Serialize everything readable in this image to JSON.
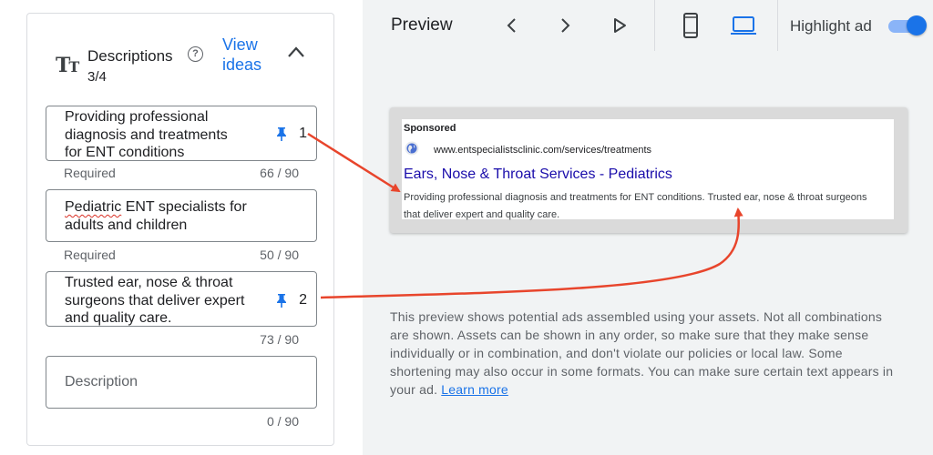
{
  "descriptions": {
    "title": "Descriptions",
    "count": "3/4",
    "view_ideas": "View ideas",
    "fields": [
      {
        "text": "Providing professional diagnosis and treatments for ENT conditions",
        "pin": "1",
        "required": "Required",
        "char_count": "66 / 90"
      },
      {
        "text_part1": "Pediatric",
        "text_part2": " ENT specialists for adults and children",
        "required": "Required",
        "char_count": "50 / 90"
      },
      {
        "text": "Trusted ear, nose & throat surgeons that deliver expert and quality care.",
        "pin": "2",
        "char_count": "73 / 90"
      },
      {
        "placeholder": "Description",
        "char_count": "0 / 90"
      }
    ]
  },
  "preview": {
    "title": "Preview",
    "highlight_label": "Highlight ad",
    "highlight_on": true,
    "selected_device": "desktop",
    "ad": {
      "sponsored": "Sponsored",
      "url": "www.entspecialistsclinic.com/services/treatments",
      "headline": "Ears, Nose & Throat Services - Pediatrics",
      "description": "Providing professional diagnosis and treatments for ENT conditions. Trusted ear, nose & throat surgeons that deliver expert and quality care."
    },
    "note": "This preview shows potential ads assembled using your assets. Not all combinations are shown. Assets can be shown in any order, so make sure that they make sense individually or in combination, and don't violate our policies or local law. Some shortening may also occur in some formats. You can make sure certain text appears in your ad.",
    "learn_more": "Learn more"
  },
  "colors": {
    "accent": "#1a73e8",
    "annotation_arrow": "#e8452c",
    "ad_headline": "#1a0dab"
  },
  "icons": [
    "text-format-icon",
    "help-icon",
    "chevron-up-icon",
    "pin-icon",
    "chevron-left-icon",
    "chevron-right-icon",
    "play-icon",
    "mobile-icon",
    "desktop-icon",
    "globe-icon"
  ]
}
